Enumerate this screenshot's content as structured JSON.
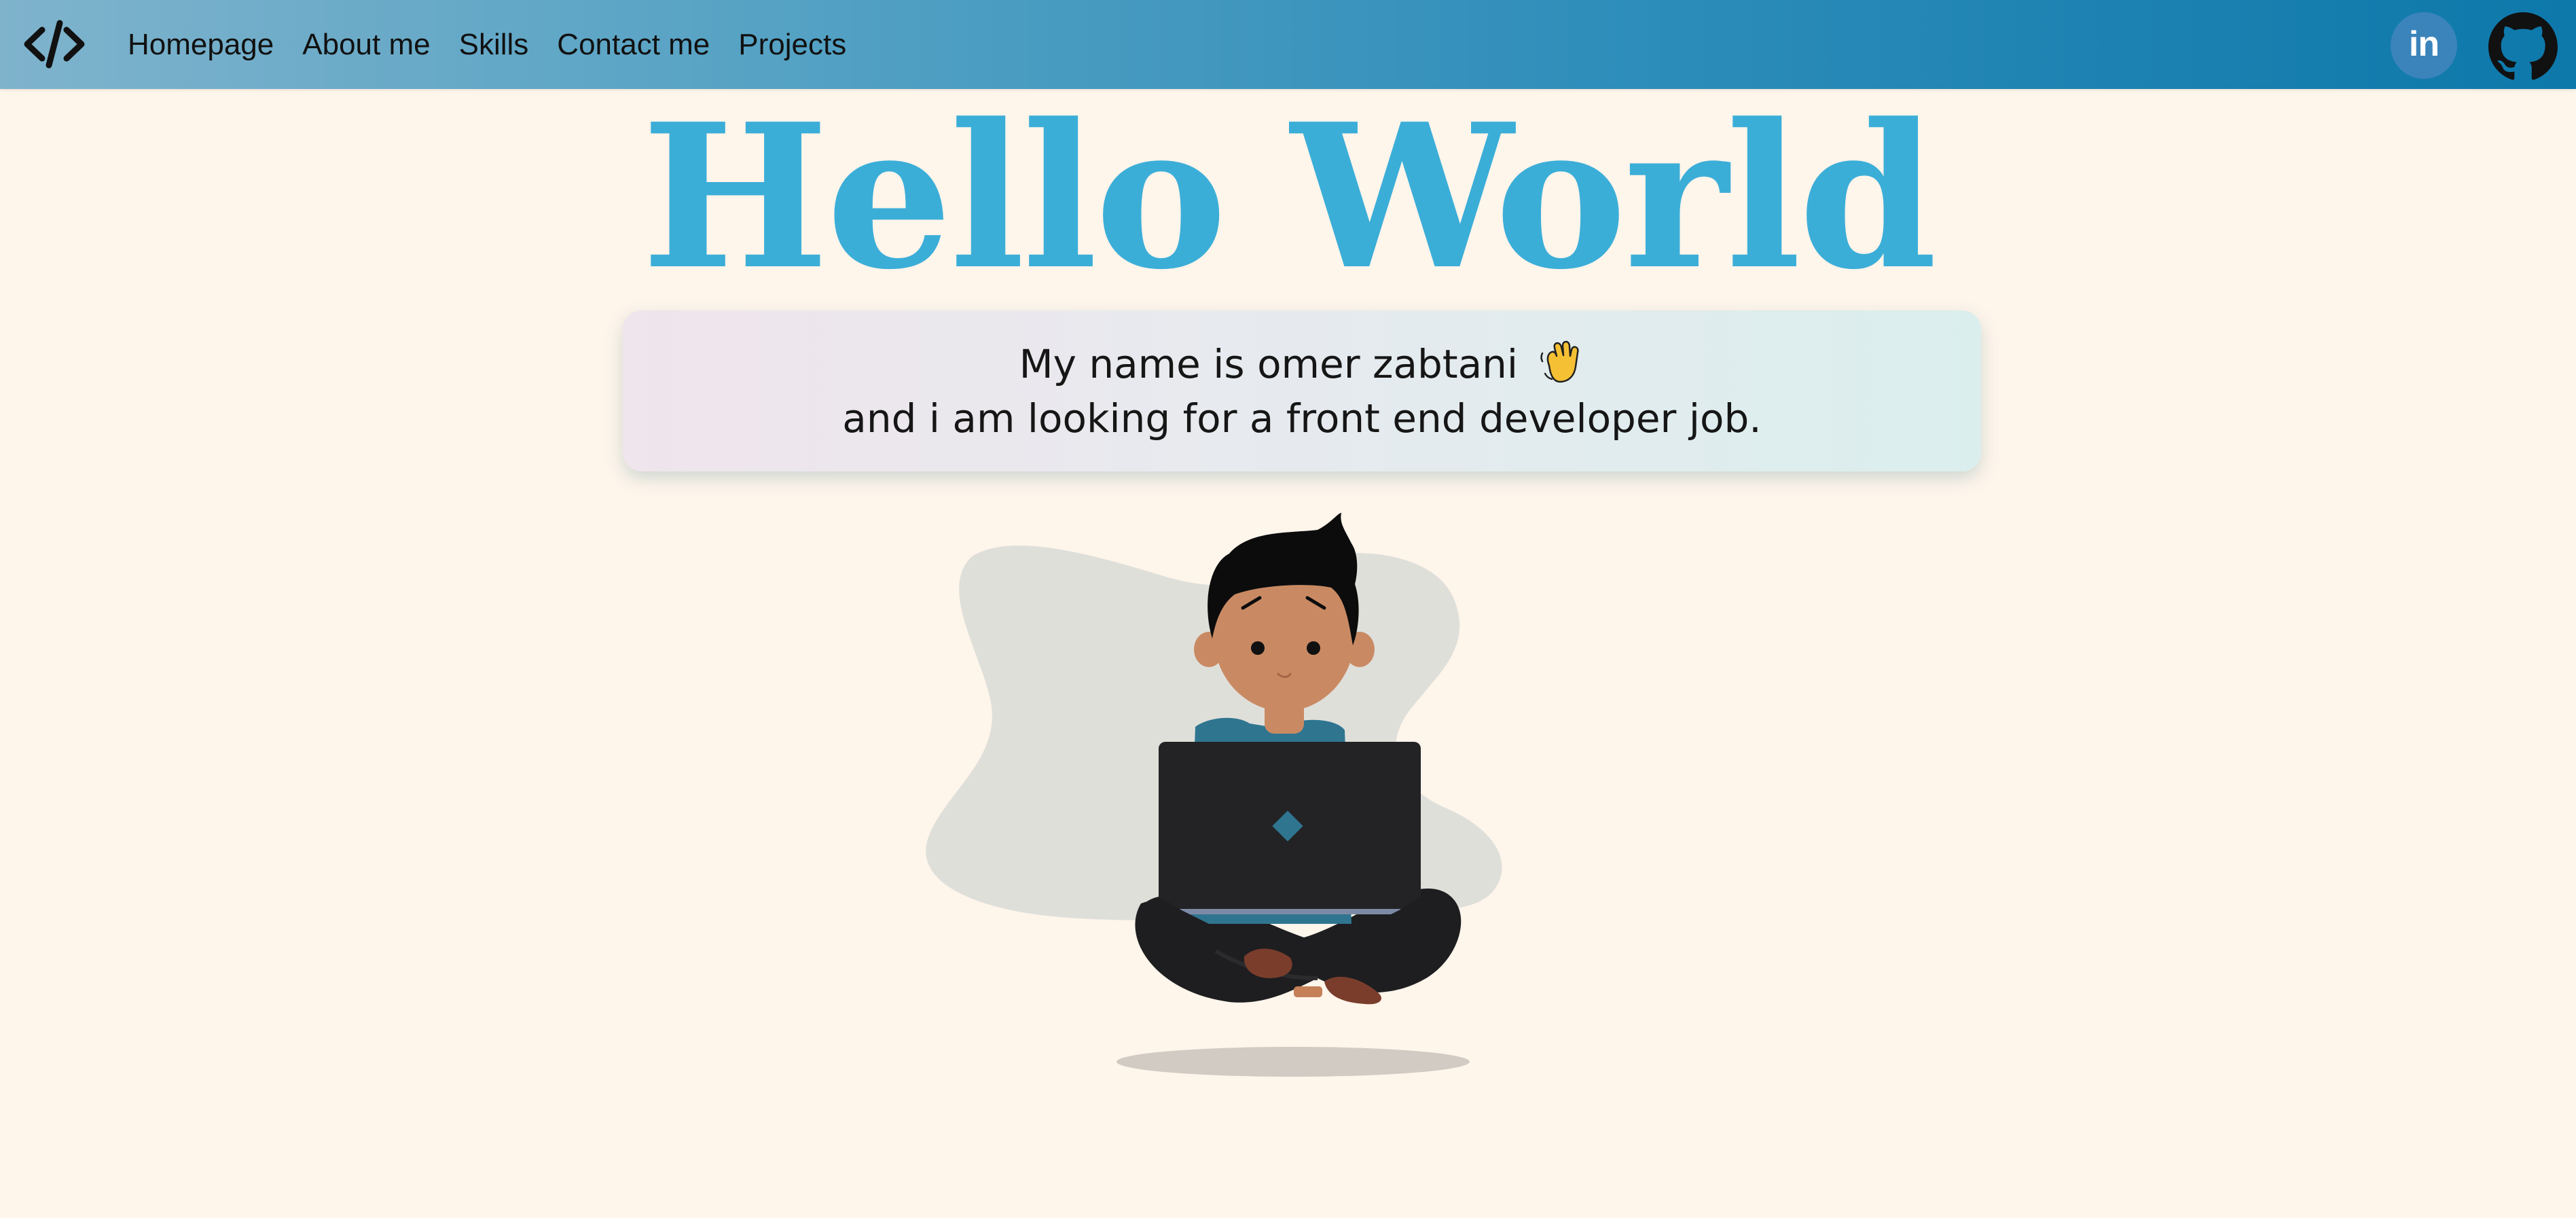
{
  "nav": {
    "logo_icon": "code-slash-icon",
    "links": [
      "Homepage",
      "About me",
      "Skills",
      "Contact me",
      "Projects"
    ],
    "social": {
      "linkedin_label": "in",
      "linkedin_icon": "linkedin-icon",
      "github_icon": "github-icon"
    },
    "colors": {
      "gradient_start": "#7fb3cc",
      "gradient_end": "#0d78aa"
    }
  },
  "hero": {
    "title": "Hello World",
    "title_color": "#3baed8",
    "intro_line_1": "My name is omer zabtani",
    "intro_line_1_icon": "waving-hand-icon",
    "intro_line_2": "and i am looking for a front end developer job."
  },
  "illustration": {
    "icon": "developer-with-laptop-illustration"
  }
}
